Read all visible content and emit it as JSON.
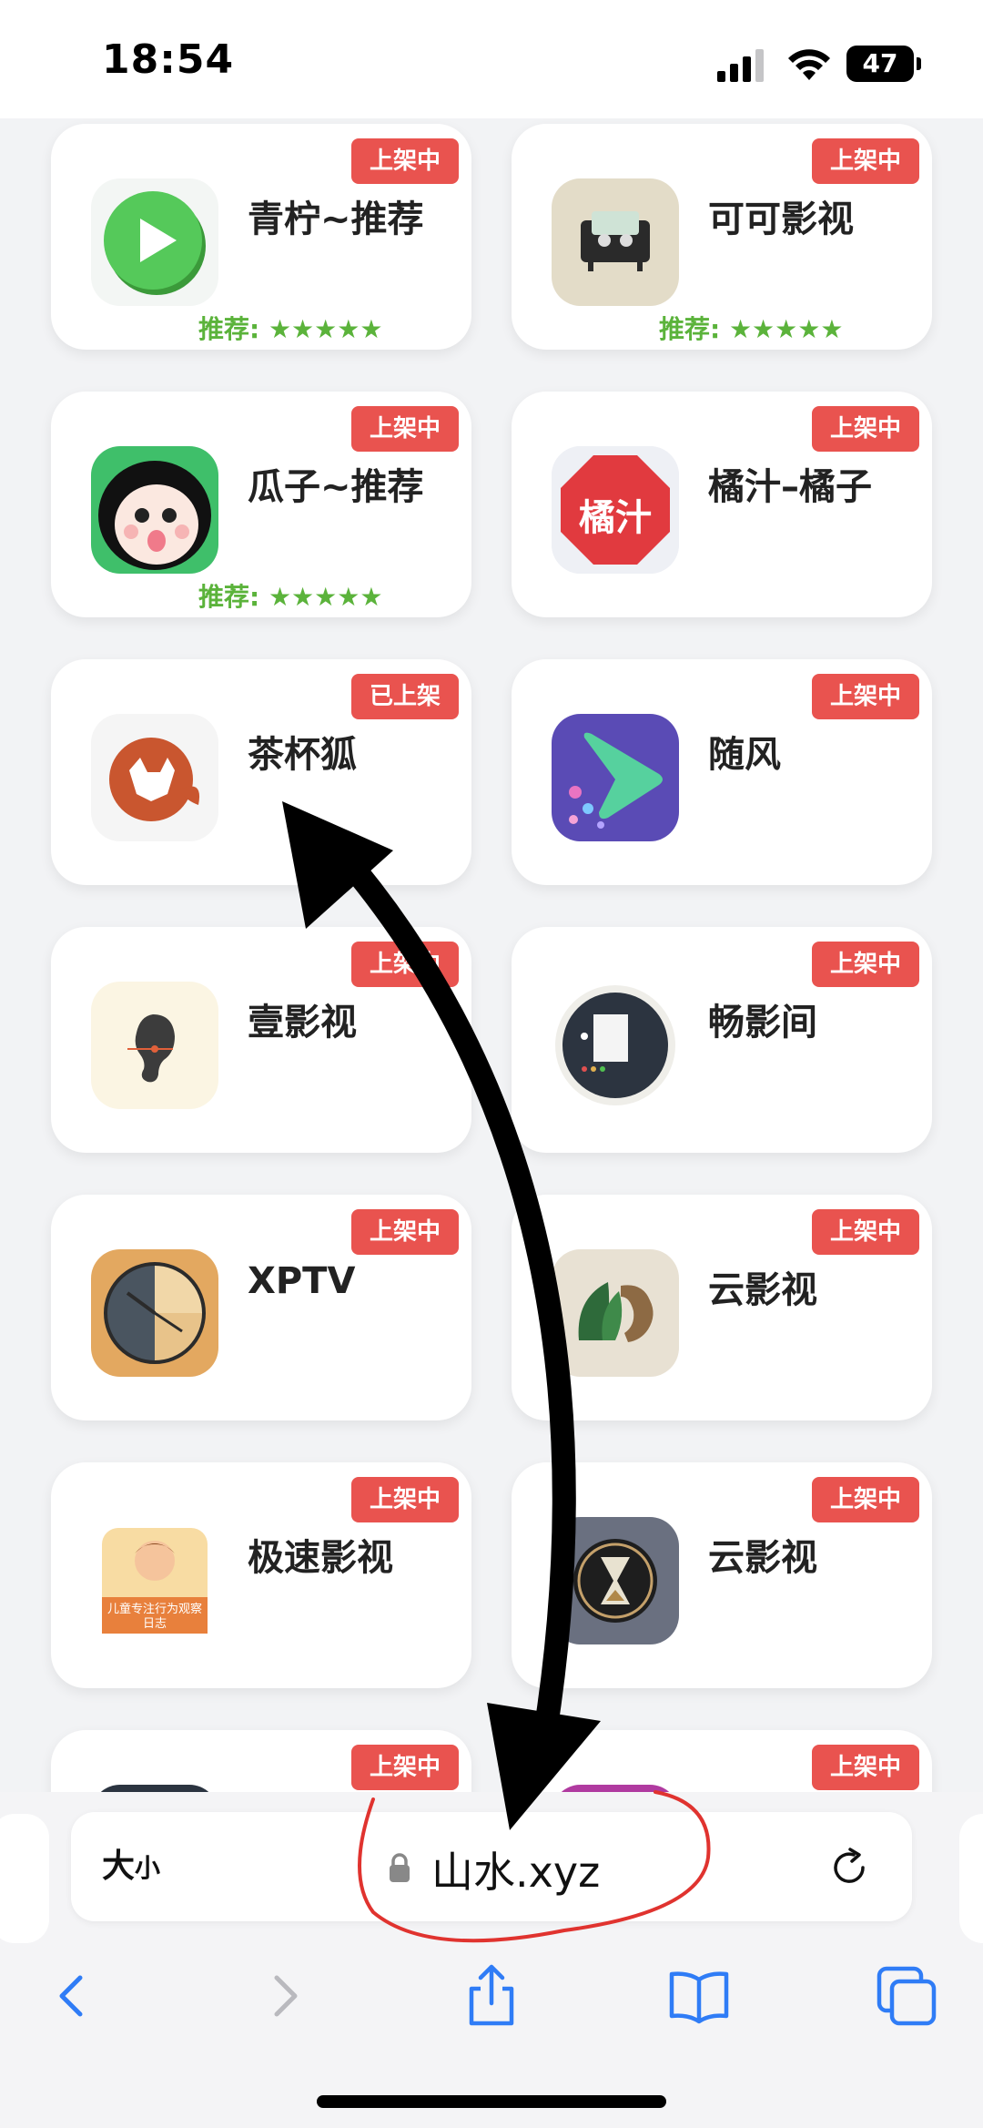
{
  "status_bar": {
    "time": "18:54",
    "battery": "47"
  },
  "apps": [
    {
      "name": "青柠~推荐",
      "badge": "上架中",
      "rating": "推荐: ★★★★★",
      "icon": "green-play-icon"
    },
    {
      "name": "可可影视",
      "badge": "上架中",
      "rating": "推荐: ★★★★★",
      "icon": "beige-tv-icon"
    },
    {
      "name": "瓜子~推荐",
      "badge": "上架中",
      "rating": "推荐: ★★★★★",
      "icon": "cartoon-face-icon"
    },
    {
      "name": "橘汁–橘子",
      "badge": "上架中",
      "rating": "",
      "icon": "orange-juice-icon",
      "icon_text": "橘汁"
    },
    {
      "name": "茶杯狐",
      "badge": "已上架",
      "rating": "",
      "icon": "fox-icon"
    },
    {
      "name": "随风",
      "badge": "上架中",
      "rating": "",
      "icon": "purple-play-icon"
    },
    {
      "name": "壹影视",
      "badge": "上架中",
      "rating": "",
      "icon": "ear-icon"
    },
    {
      "name": "畅影间",
      "badge": "上架中",
      "rating": "",
      "icon": "dark-document-icon"
    },
    {
      "name": "XPTV",
      "badge": "上架中",
      "rating": "",
      "icon": "clock-icon"
    },
    {
      "name": "云影视",
      "badge": "上架中",
      "rating": "",
      "icon": "lion-leaf-icon"
    },
    {
      "name": "极速影视",
      "badge": "上架中",
      "rating": "",
      "icon": "child-reading-icon",
      "icon_text": "儿童专注行为观察日志"
    },
    {
      "name": "云影视",
      "badge": "上架中",
      "rating": "",
      "icon": "hourglass-icon"
    },
    {
      "name": "",
      "badge": "上架中",
      "rating": "",
      "icon": "partial-icon"
    },
    {
      "name": "",
      "badge": "上架中",
      "rating": "",
      "icon": "partial-icon"
    }
  ],
  "address_bar": {
    "text_size_label": "大",
    "text_size_small": "小",
    "url": "山水.xyz"
  },
  "annotation_colors": {
    "arrow": "#000000",
    "circle": "#e0332f",
    "badge": "#e9534f",
    "rating": "#5bb33b",
    "link": "#2f7cf6"
  }
}
